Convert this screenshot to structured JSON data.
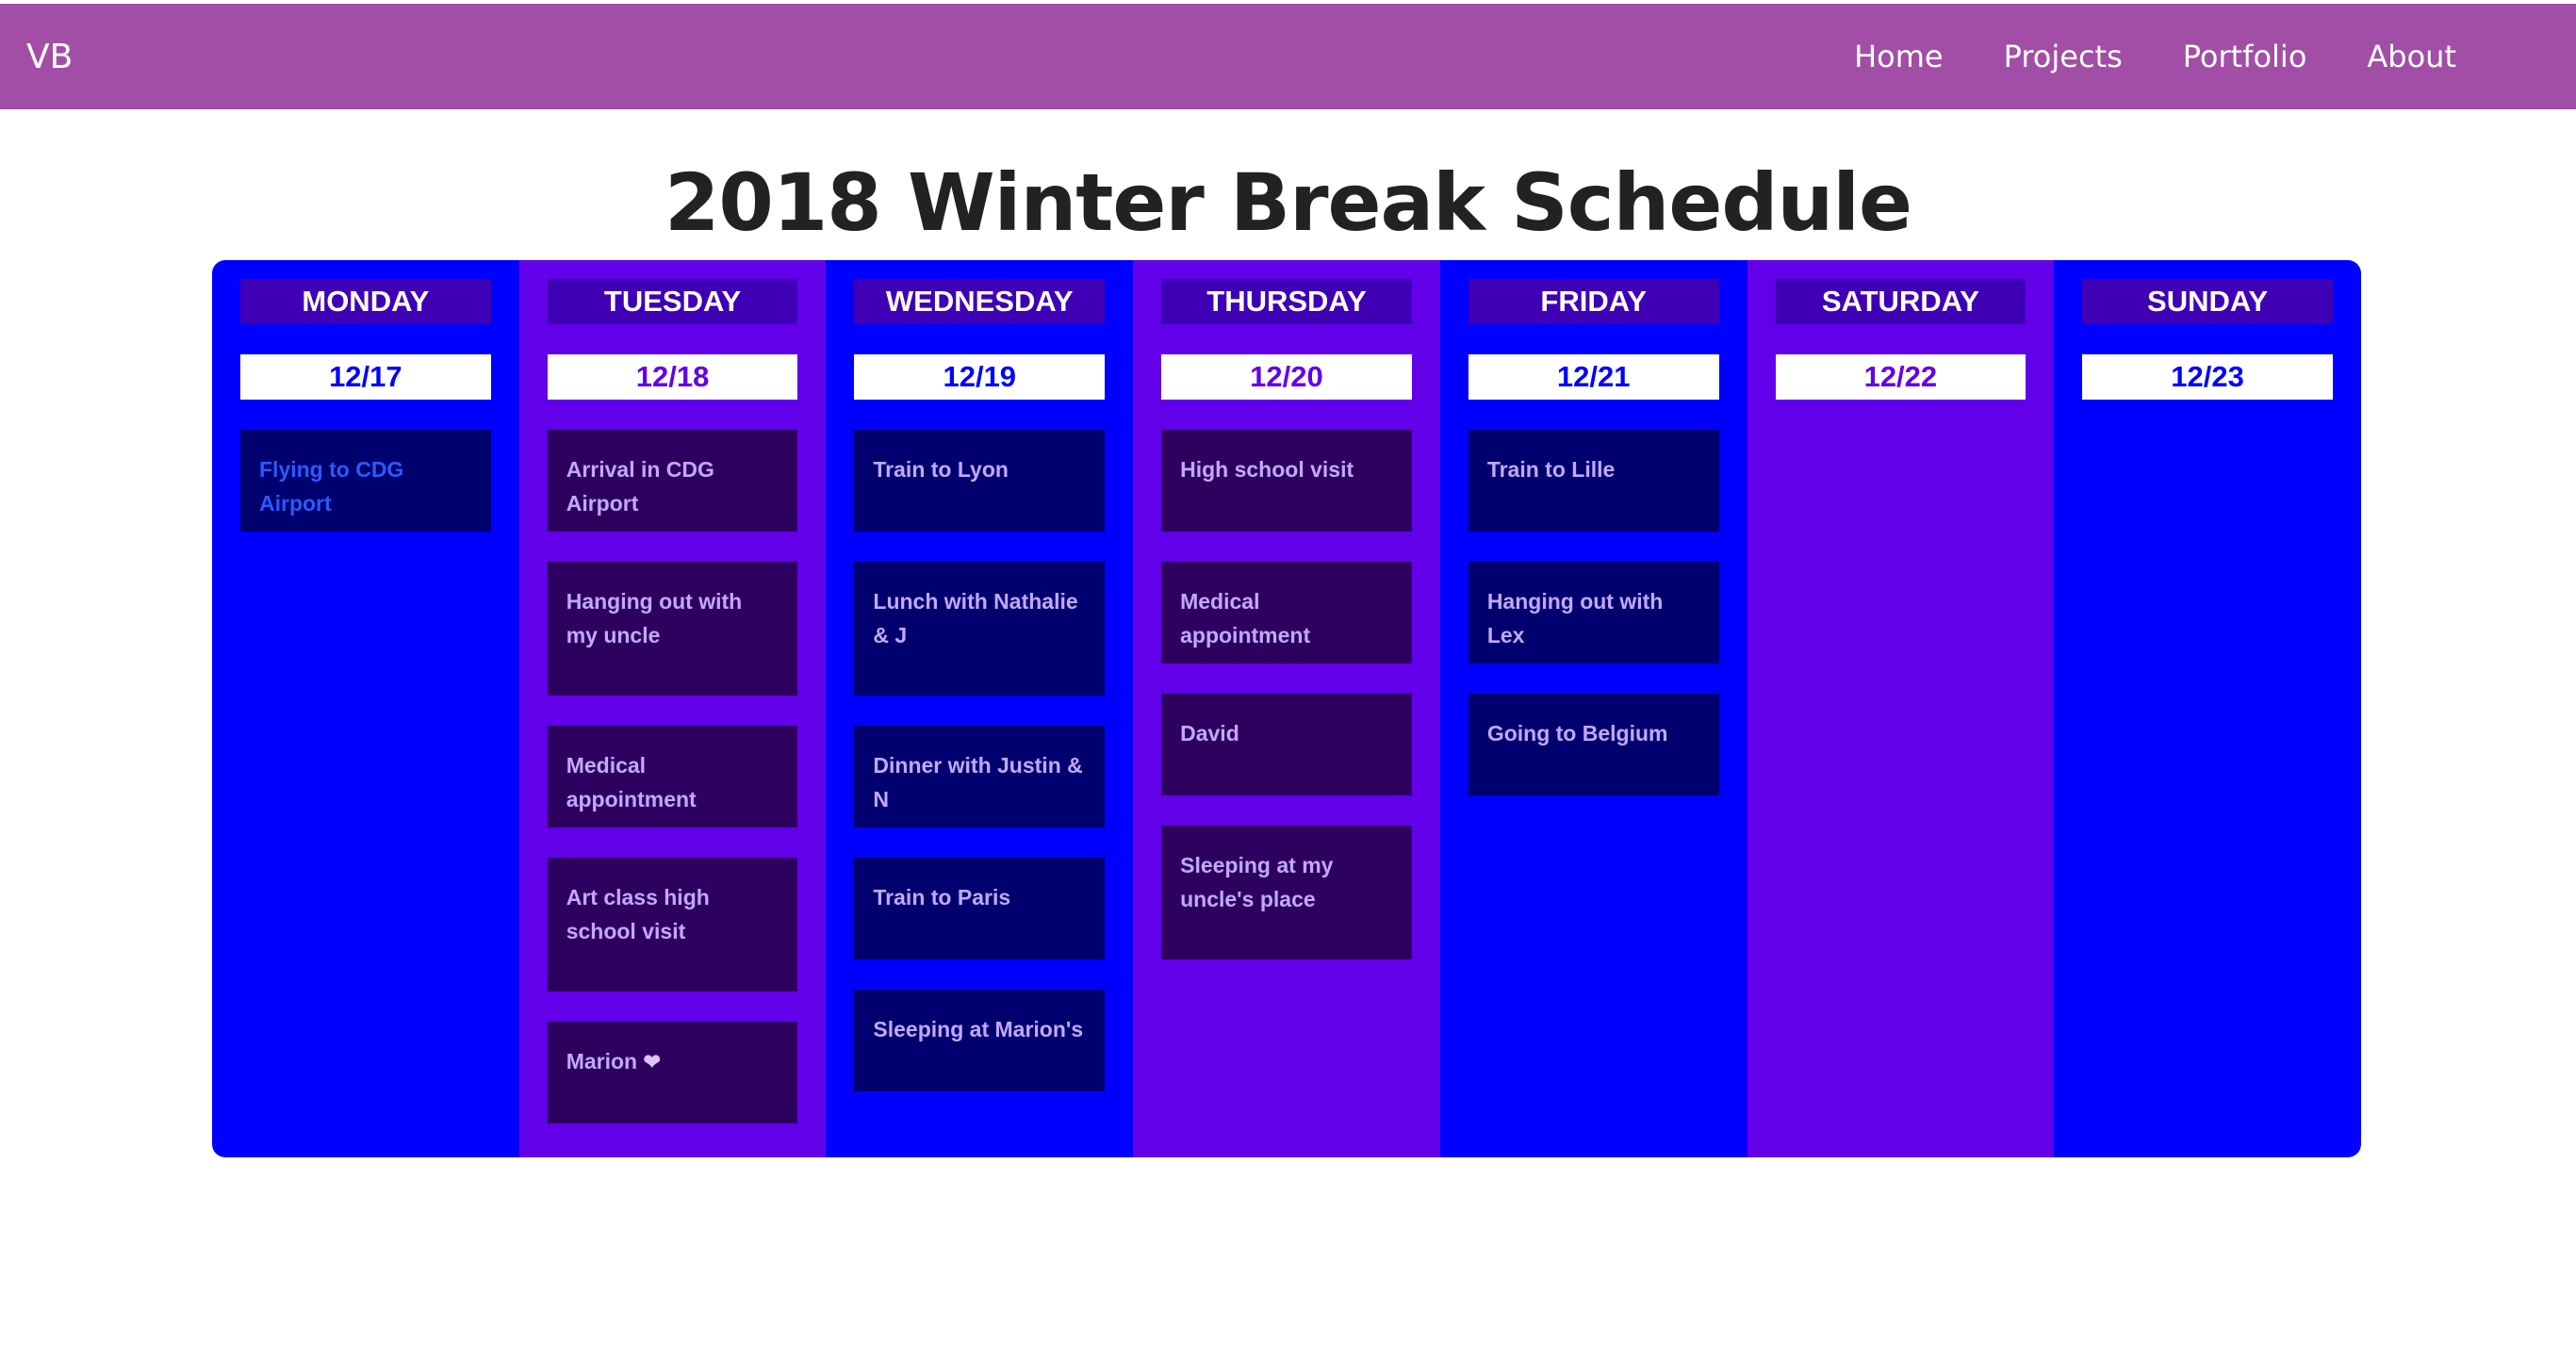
{
  "nav": {
    "brand": "VB",
    "links": [
      "Home",
      "Projects",
      "Portfolio",
      "About"
    ]
  },
  "title": "2018 Winter Break Schedule",
  "colors": {
    "navbar": "#a24ea6",
    "column_blue": "#0000ff",
    "column_purple": "#6200ea",
    "day_header": "#3f00b5",
    "event_blue": "#00006e",
    "event_purple": "#2d0060",
    "event_text": "#c2a8ff"
  },
  "days": [
    {
      "name": "MONDAY",
      "date": "12/17",
      "events": [
        "Flying to CDG Airport"
      ]
    },
    {
      "name": "TUESDAY",
      "date": "12/18",
      "events": [
        "Arrival in CDG Airport",
        "Hanging out with my uncle",
        "Medical appointment",
        "Art class high school visit",
        "Marion"
      ]
    },
    {
      "name": "WEDNESDAY",
      "date": "12/19",
      "events": [
        "Train to Lyon",
        "Lunch with Nathalie & J",
        "Dinner with Justin & N",
        "Train to Paris",
        "Sleeping at Marion's"
      ]
    },
    {
      "name": "THURSDAY",
      "date": "12/20",
      "events": [
        "High school visit",
        "Medical appointment",
        "David",
        "Sleeping at my uncle's place"
      ]
    },
    {
      "name": "FRIDAY",
      "date": "12/21",
      "events": [
        "Train to Lille",
        "Hanging out with Lex",
        "Going to Belgium"
      ]
    },
    {
      "name": "SATURDAY",
      "date": "12/22",
      "events": []
    },
    {
      "name": "SUNDAY",
      "date": "12/23",
      "events": []
    }
  ],
  "icons": {
    "heart": "heart-icon"
  }
}
